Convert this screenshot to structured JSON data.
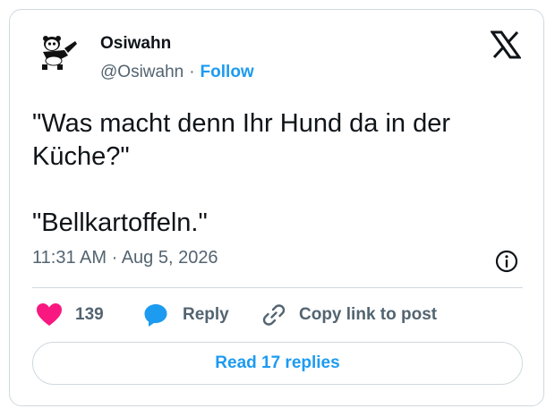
{
  "tweet": {
    "author_name": "Osiwahn",
    "handle": "@Osiwahn",
    "separator": "·",
    "follow_label": "Follow",
    "text_lines": [
      "\"Was macht denn Ihr Hund da in der",
      "Küche?\"",
      "\"Bellkartoffeln.\""
    ],
    "timestamp": "11:31 AM · Aug 5, 2026"
  },
  "actions": {
    "like_count": "139",
    "reply_label": "Reply",
    "copy_link_label": "Copy link to post"
  },
  "read_replies_label": "Read 17 replies",
  "icons": {
    "logo": "x-logo-icon",
    "avatar": "panda-avatar",
    "info": "info-icon",
    "like": "heart-icon",
    "reply": "speech-bubble-icon",
    "copy": "link-icon"
  },
  "colors": {
    "accent": "#1d9bf0",
    "like": "#f91880",
    "text": "#0f1419",
    "secondary": "#536471",
    "border": "#cfd9de"
  }
}
